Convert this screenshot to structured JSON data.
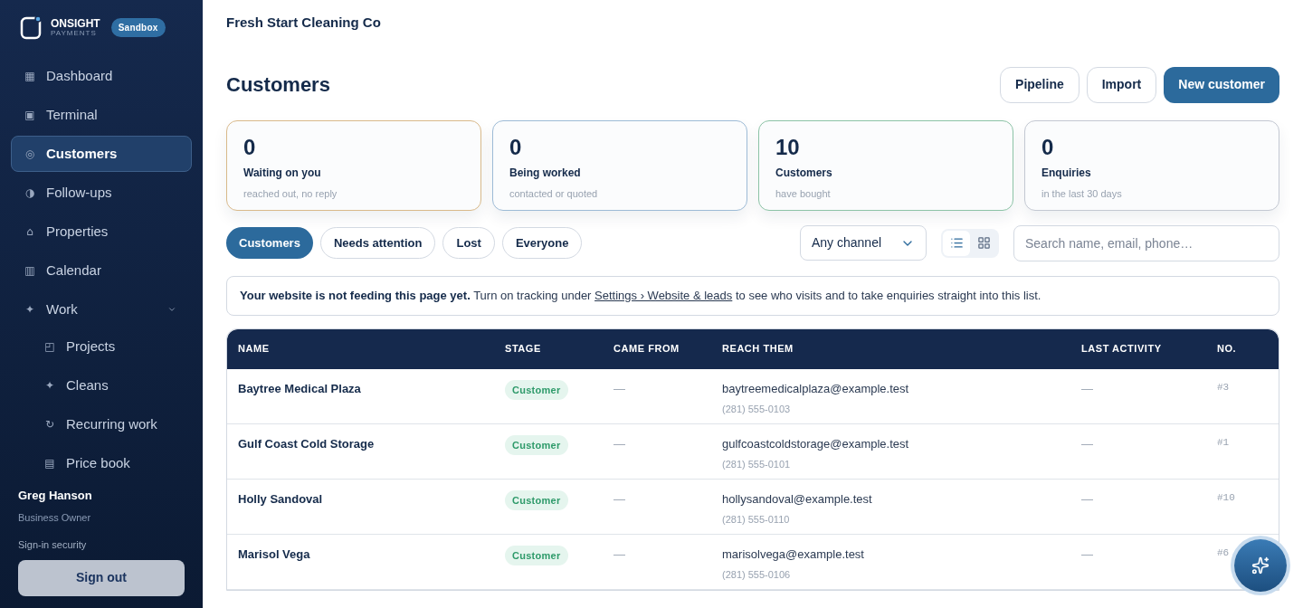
{
  "sidebar": {
    "logo": {
      "name": "ONSIGHT",
      "tagline": "PAYMENTS",
      "badge": "Sandbox"
    },
    "items": [
      {
        "icon": "▦",
        "label": "Dashboard",
        "selected": false
      },
      {
        "icon": "▣",
        "label": "Terminal",
        "selected": false
      },
      {
        "icon": "◎",
        "label": "Customers",
        "selected": true
      },
      {
        "icon": "◑",
        "label": "Follow-ups",
        "selected": false
      },
      {
        "icon": "⌂",
        "label": "Properties",
        "selected": false
      },
      {
        "icon": "▥",
        "label": "Calendar",
        "selected": false
      },
      {
        "icon": "✦",
        "label": "Work",
        "selected": false,
        "expanded": true,
        "children": [
          {
            "icon": "◰",
            "label": "Projects",
            "selected": false
          },
          {
            "icon": "✦",
            "label": "Cleans",
            "selected": false
          },
          {
            "icon": "↻",
            "label": "Recurring work",
            "selected": false
          },
          {
            "icon": "▤",
            "label": "Price book",
            "selected": false
          }
        ]
      }
    ],
    "user": {
      "name": "Greg Hanson",
      "role": "Business Owner",
      "security_link": "Sign-in security",
      "sign_out": "Sign out"
    }
  },
  "header": {
    "company": "Fresh Start Cleaning Co"
  },
  "page": {
    "title": "Customers",
    "buttons": [
      {
        "label": "Pipeline",
        "kind": "outline"
      },
      {
        "label": "Import",
        "kind": "outline"
      },
      {
        "label": "New customer",
        "kind": "primary"
      }
    ]
  },
  "stats": [
    {
      "value": "0",
      "label": "Waiting on you",
      "sub": "reached out, no reply",
      "color": "#d9b98a"
    },
    {
      "value": "0",
      "label": "Being worked",
      "sub": "contacted or quoted",
      "color": "#9dbbd6"
    },
    {
      "value": "10",
      "label": "Customers",
      "sub": "have bought",
      "color": "#8cc3a6"
    },
    {
      "value": "0",
      "label": "Enquiries",
      "sub": "in the last 30 days",
      "color": "#c3c8d2"
    }
  ],
  "filters": [
    {
      "label": "Customers",
      "selected": true
    },
    {
      "label": "Needs attention",
      "selected": false
    },
    {
      "label": "Lost",
      "selected": false
    },
    {
      "label": "Everyone",
      "selected": false
    }
  ],
  "channel_select": {
    "value": "Any channel"
  },
  "view_toggle": [
    {
      "kind": "list",
      "selected": true
    },
    {
      "kind": "grid",
      "selected": false
    }
  ],
  "search": {
    "placeholder": "Search name, email, phone…"
  },
  "notice": {
    "bold": "Your website is not feeding this page yet.",
    "before": "Turn on tracking under",
    "link": "Settings › Website & leads",
    "after": "to see who visits and to take enquiries straight into this list."
  },
  "table": {
    "columns": [
      "NAME",
      "STAGE",
      "CAME FROM",
      "REACH THEM",
      "LAST ACTIVITY",
      "NO."
    ],
    "rows": [
      {
        "name": "Baytree Medical Plaza",
        "stage": "Customer",
        "came_from": "—",
        "email": "baytreemedicalplaza@example.test",
        "phone": "(281) 555-0103",
        "last_activity": "—",
        "no": "#3"
      },
      {
        "name": "Gulf Coast Cold Storage",
        "stage": "Customer",
        "came_from": "—",
        "email": "gulfcoastcoldstorage@example.test",
        "phone": "(281) 555-0101",
        "last_activity": "—",
        "no": "#1"
      },
      {
        "name": "Holly Sandoval",
        "stage": "Customer",
        "came_from": "—",
        "email": "hollysandoval@example.test",
        "phone": "(281) 555-0110",
        "last_activity": "—",
        "no": "#10"
      },
      {
        "name": "Marisol Vega",
        "stage": "Customer",
        "came_from": "—",
        "email": "marisolvega@example.test",
        "phone": "(281) 555-0106",
        "last_activity": "—",
        "no": "#6"
      }
    ]
  }
}
